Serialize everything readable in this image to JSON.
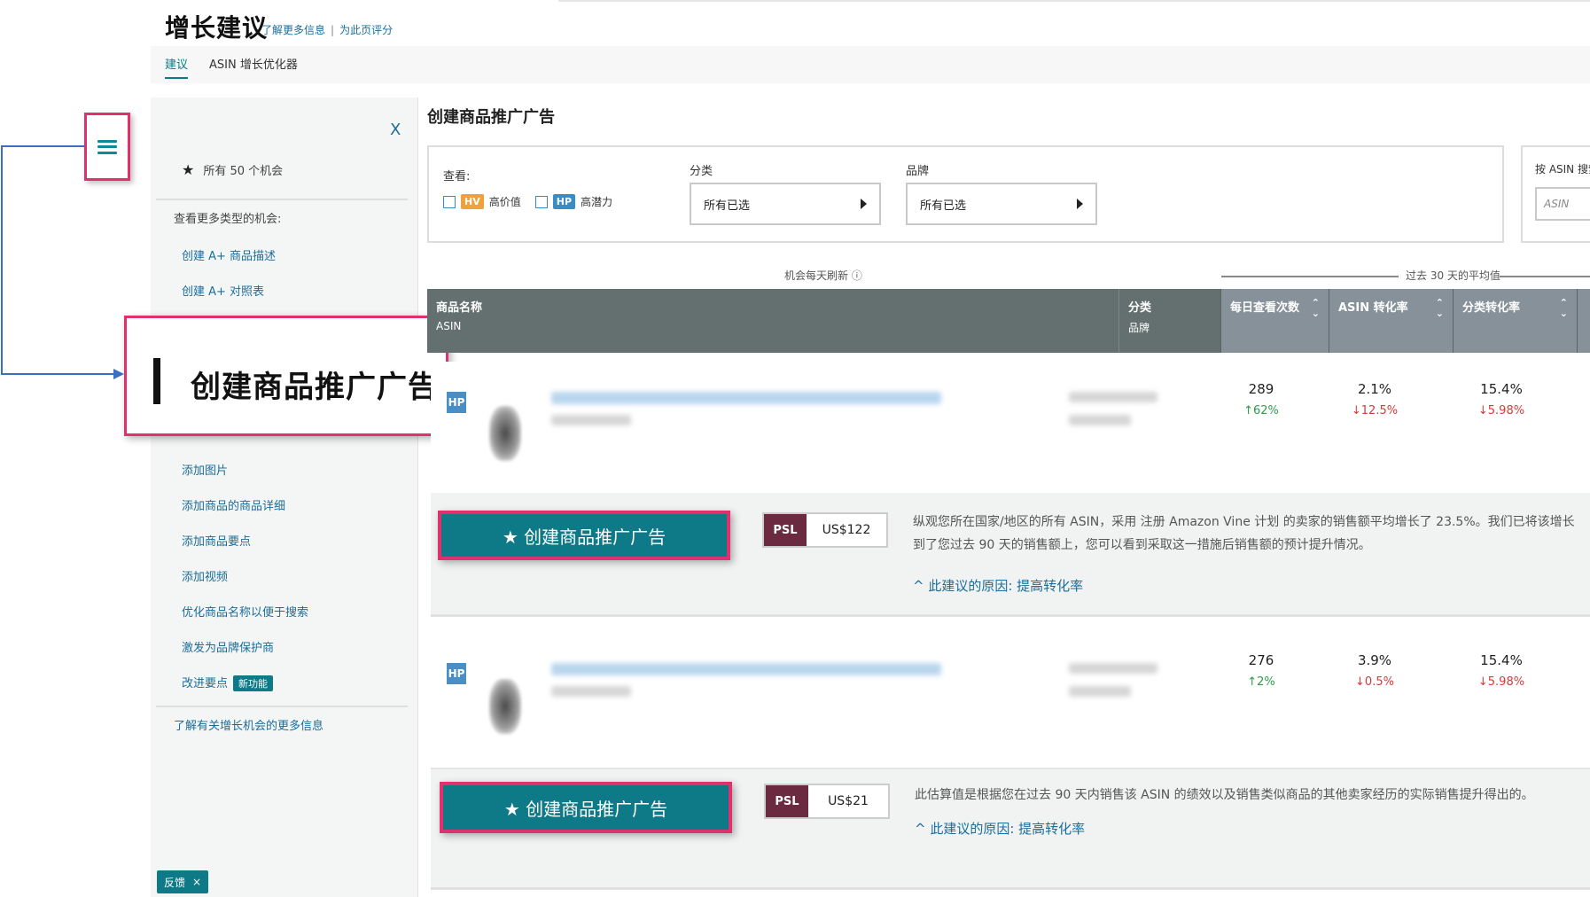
{
  "header": {
    "title": "增长建议",
    "links": [
      "了解更多信息",
      "为此页评分"
    ],
    "tabs": [
      {
        "label": "建议",
        "active": true
      },
      {
        "label": "ASIN 增长优化器",
        "active": false
      }
    ]
  },
  "sidebar": {
    "close_label": "X",
    "all_opportunities": "所有 50 个机会",
    "section_title": "查看更多类型的机会:",
    "items": [
      "创建 A+ 商品描述",
      "创建 A+ 对照表",
      "添加图片",
      "添加商品的商品详细",
      "添加商品要点",
      "添加视频",
      "优化商品名称以便于搜索",
      "激发为品牌保护商",
      "改进要点"
    ],
    "hidden_item": "创建商品推广",
    "new_badge": "新功能",
    "footer_link": "了解有关增长机会的更多信息",
    "feedback": "反馈",
    "feedback_close": "×"
  },
  "callout": {
    "zoom_text": "创建商品推广广告"
  },
  "main": {
    "title": "创建商品推广广告",
    "filters": {
      "query_label": "查看:",
      "hv_tag": "HV",
      "hv_label": "高价值",
      "hp_tag": "HP",
      "hp_label": "高潜力",
      "category_label": "分类",
      "category_value": "所有已选",
      "brand_label": "品牌",
      "brand_value": "所有已选"
    },
    "asin_search": {
      "label": "按 ASIN 搜索",
      "placeholder": "ASIN"
    },
    "meta_refresh": "机会每天刷新 ⓘ",
    "meta_avg": "过去 30 天的平均值",
    "columns": {
      "product": "商品名称",
      "product_sub": "ASIN",
      "category": "分类",
      "category_sub": "品牌",
      "daily_views": "每日查看次数",
      "asin_cvr": "ASIN 转化率",
      "cat_cvr": "分类转化率"
    },
    "rows": [
      {
        "tag": "HP",
        "daily_views": "289",
        "daily_views_delta": "↑62%",
        "asin_cvr": "2.1%",
        "asin_cvr_delta": "↓12.5%",
        "cat_cvr": "15.4%",
        "cat_cvr_delta": "↓5.98%",
        "cta_label": "★ 创建商品推广广告",
        "psl_tag": "PSL",
        "psl_value": "US$122",
        "desc_line1": "纵观您所在国家/地区的所有 ASIN，采用 注册 Amazon Vine 计划 的卖家的销售额平均增长了 23.5%。我们已将该增长",
        "desc_line2": "到了您过去 90 天的销售额上，您可以看到采取这一措施后销售额的预计提升情况。",
        "reason": "^ 此建议的原因:  提高转化率"
      },
      {
        "tag": "HP",
        "daily_views": "276",
        "daily_views_delta": "↑2%",
        "asin_cvr": "3.9%",
        "asin_cvr_delta": "↓0.5%",
        "cat_cvr": "15.4%",
        "cat_cvr_delta": "↓5.98%",
        "cta_label": "★ 创建商品推广广告",
        "psl_tag": "PSL",
        "psl_value": "US$21",
        "desc_line1": "此估算值是根据您在过去 90 天内销售该 ASIN 的绩效以及销售类似商品的其他卖家经历的实际销售提升得出的。",
        "desc_line2": "",
        "reason": "^ 此建议的原因:  提高转化率"
      }
    ]
  },
  "colors": {
    "accent": "#0e7a87",
    "highlight": "#e0306d",
    "header_dark": "#64706f",
    "link": "#1a6e9b",
    "up": "#2e9a4a",
    "down": "#d43a3a",
    "psl": "#6b2a3f"
  }
}
